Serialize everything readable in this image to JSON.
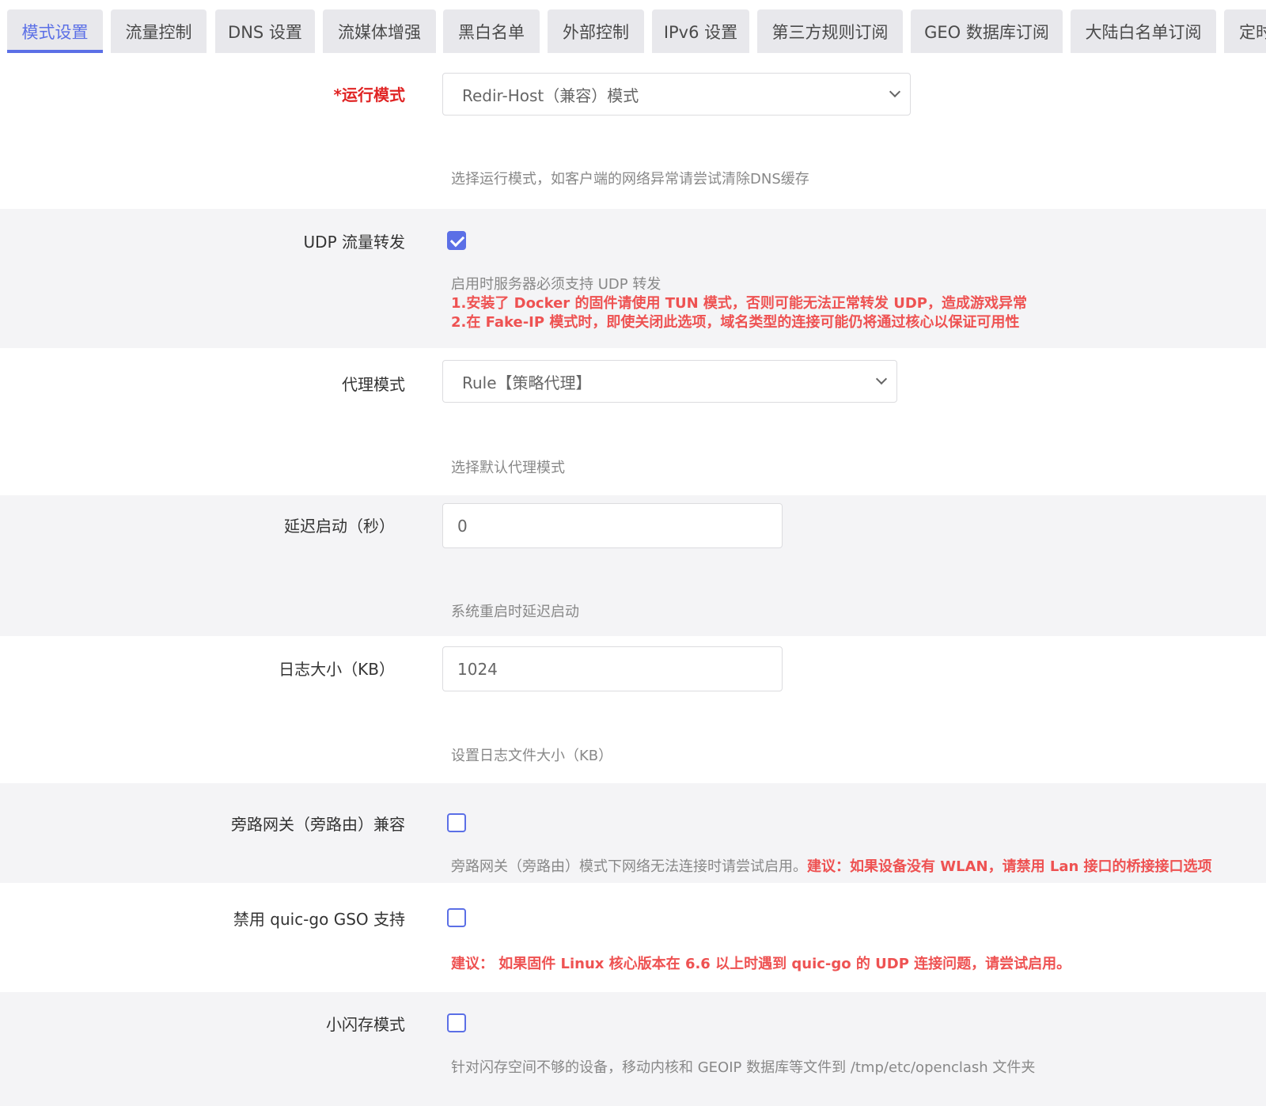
{
  "tabs": [
    {
      "label": "模式设置",
      "active": true
    },
    {
      "label": "流量控制"
    },
    {
      "label": "DNS 设置"
    },
    {
      "label": "流媒体增强"
    },
    {
      "label": "黑白名单"
    },
    {
      "label": "外部控制"
    },
    {
      "label": "IPv6 设置"
    },
    {
      "label": "第三方规则订阅"
    },
    {
      "label": "GEO 数据库订阅"
    },
    {
      "label": "大陆白名单订阅"
    },
    {
      "label": "定时"
    }
  ],
  "colors": {
    "accent": "#5b6fe6",
    "required": "#e02424",
    "warning": "#ee5252",
    "shaded_row": "#f4f4f6"
  },
  "run_mode": {
    "label": "*运行模式",
    "value": "Redir-Host（兼容）模式",
    "desc": "选择运行模式，如客户端的网络异常请尝试清除DNS缓存"
  },
  "udp_forward": {
    "label": "UDP 流量转发",
    "checked": true,
    "desc": "启用时服务器必须支持 UDP 转发",
    "warn1": "1.安装了 Docker 的固件请使用 TUN 模式，否则可能无法正常转发 UDP，造成游戏异常",
    "warn2": "2.在 Fake-IP 模式时，即使关闭此选项，域名类型的连接可能仍将通过核心以保证可用性"
  },
  "proxy_mode": {
    "label": "代理模式",
    "value": "Rule【策略代理】",
    "desc": "选择默认代理模式"
  },
  "delay_start": {
    "label": "延迟启动（秒）",
    "value": "0",
    "desc": "系统重启时延迟启动"
  },
  "log_size": {
    "label": "日志大小（KB）",
    "value": "1024",
    "desc": "设置日志文件大小（KB）"
  },
  "bypass_gateway": {
    "label": "旁路网关（旁路由）兼容",
    "checked": false,
    "desc": "旁路网关（旁路由）模式下网络无法连接时请尝试启用。",
    "warn": "建议：如果设备没有 WLAN，请禁用 Lan 接口的桥接接口选项"
  },
  "quic_gso": {
    "label": "禁用 quic-go GSO 支持",
    "checked": false,
    "warn": "建议： 如果固件 Linux 核心版本在 6.6 以上时遇到 quic-go 的 UDP 连接问题，请尝试启用。"
  },
  "small_flash": {
    "label": "小闪存模式",
    "checked": false,
    "desc": "针对闪存空间不够的设备，移动内核和 GEOIP 数据库等文件到 /tmp/etc/openclash 文件夹"
  }
}
